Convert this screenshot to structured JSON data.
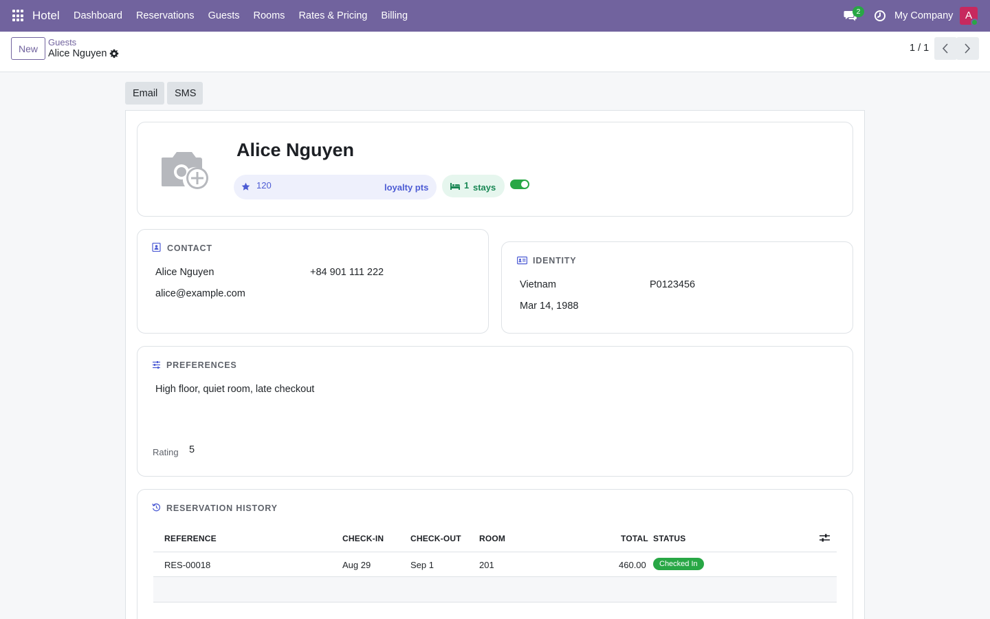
{
  "app": {
    "name": "Hotel"
  },
  "nav": {
    "menu": [
      "Dashboard",
      "Reservations",
      "Guests",
      "Rooms",
      "Rates & Pricing",
      "Billing"
    ],
    "messages_count": "2",
    "company": "My Company",
    "avatar_initial": "A"
  },
  "control": {
    "new_label": "New",
    "breadcrumb_parent": "Guests",
    "breadcrumb_current": "Alice Nguyen",
    "pager": "1 / 1"
  },
  "actions": {
    "email": "Email",
    "sms": "SMS"
  },
  "guest": {
    "name": "Alice Nguyen",
    "loyalty_points": "120",
    "loyalty_label": "loyalty pts",
    "stays_count": "1",
    "stays_label": "stays",
    "active": true
  },
  "contact": {
    "title": "CONTACT",
    "name": "Alice Nguyen",
    "phone": "+84 901 111 222",
    "email": "alice@example.com"
  },
  "identity": {
    "title": "IDENTITY",
    "country": "Vietnam",
    "document_number": "P0123456",
    "birthdate": "Mar 14, 1988"
  },
  "preferences": {
    "title": "PREFERENCES",
    "text": "High floor, quiet room, late checkout",
    "rating_label": "Rating",
    "rating_value": "5"
  },
  "history": {
    "title": "RESERVATION HISTORY",
    "columns": [
      "REFERENCE",
      "CHECK-IN",
      "CHECK-OUT",
      "ROOM",
      "TOTAL",
      "STATUS"
    ],
    "rows": [
      {
        "reference": "RES-00018",
        "check_in": "Aug 29",
        "check_out": "Sep 1",
        "room": "201",
        "total": "460.00",
        "status": "Checked In"
      }
    ]
  },
  "colors": {
    "brand": "#71639e",
    "success": "#28a745",
    "accent": "#4c5bd4",
    "avatar": "#c7295e"
  },
  "icons": [
    "apps-icon",
    "chat-icon",
    "clock-icon",
    "gear-icon",
    "chevron-left-icon",
    "chevron-right-icon",
    "camera-plus-icon",
    "star-icon",
    "bed-icon",
    "contact-card-icon",
    "id-card-icon",
    "sliders-icon",
    "history-icon",
    "optional-columns-icon"
  ]
}
